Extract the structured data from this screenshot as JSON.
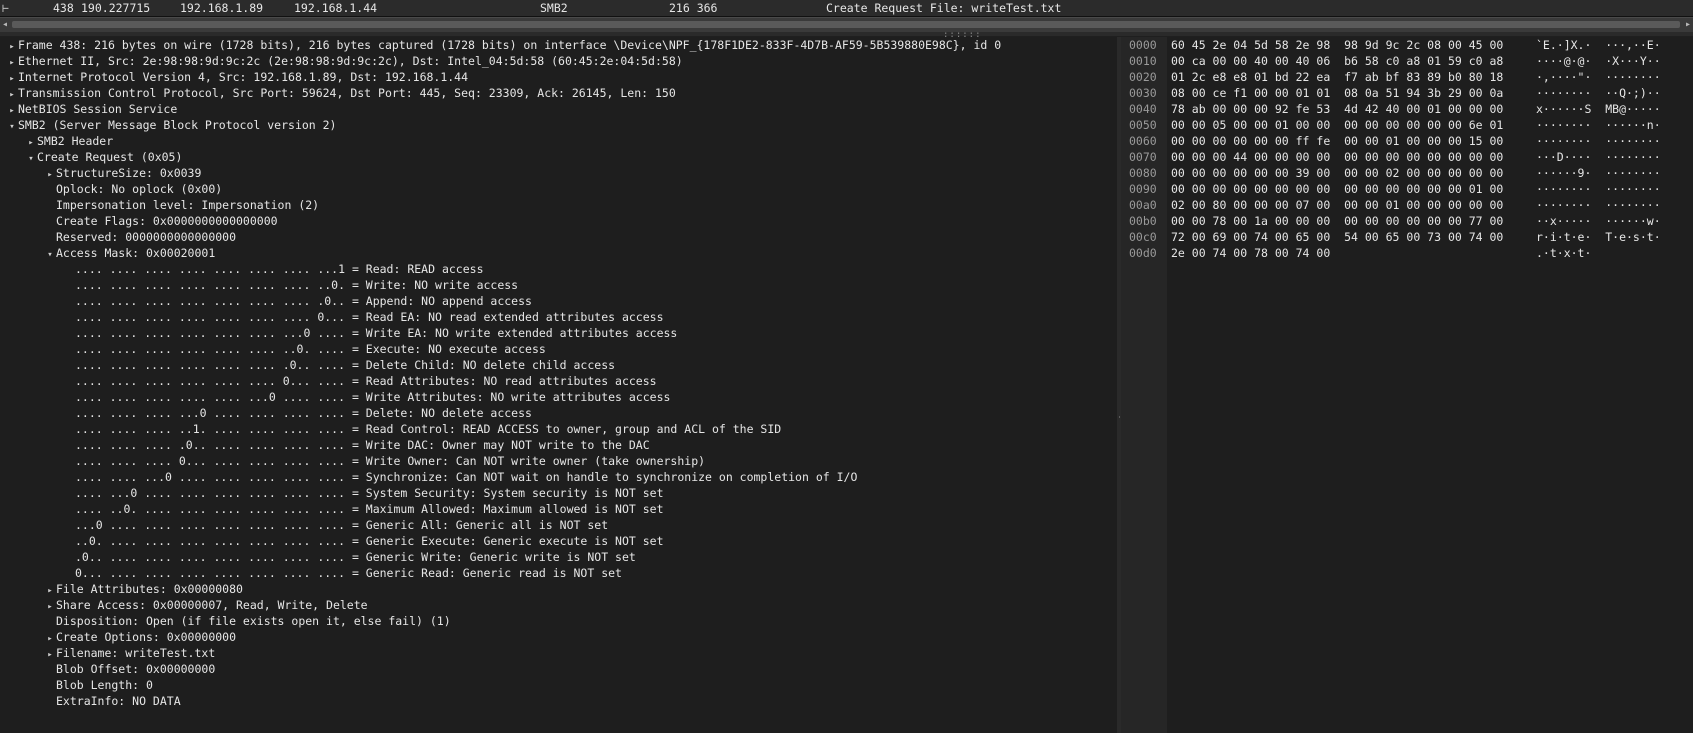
{
  "packet_list": {
    "row": {
      "marker": "⊢",
      "no": "438",
      "time": "190.227715",
      "source": "192.168.1.89",
      "destination": "192.168.1.44",
      "protocol": "SMB2",
      "length": "216 366",
      "info": "Create Request File: writeTest.txt"
    }
  },
  "detail_tree": [
    {
      "level": 0,
      "tw": "▸",
      "text": "Frame 438: 216 bytes on wire (1728 bits), 216 bytes captured (1728 bits) on interface \\Device\\NPF_{178F1DE2-833F-4D7B-AF59-5B539880E98C}, id 0"
    },
    {
      "level": 0,
      "tw": "▸",
      "text": "Ethernet II, Src: 2e:98:98:9d:9c:2c (2e:98:98:9d:9c:2c), Dst: Intel_04:5d:58 (60:45:2e:04:5d:58)"
    },
    {
      "level": 0,
      "tw": "▸",
      "text": "Internet Protocol Version 4, Src: 192.168.1.89, Dst: 192.168.1.44"
    },
    {
      "level": 0,
      "tw": "▸",
      "text": "Transmission Control Protocol, Src Port: 59624, Dst Port: 445, Seq: 23309, Ack: 26145, Len: 150"
    },
    {
      "level": 0,
      "tw": "▸",
      "text": "NetBIOS Session Service"
    },
    {
      "level": 0,
      "tw": "▾",
      "text": "SMB2 (Server Message Block Protocol version 2)"
    },
    {
      "level": 1,
      "tw": "▸",
      "text": "SMB2 Header"
    },
    {
      "level": 1,
      "tw": "▾",
      "text": "Create Request (0x05)"
    },
    {
      "level": 2,
      "tw": "▸",
      "text": "StructureSize: 0x0039"
    },
    {
      "level": 2,
      "tw": "",
      "text": "Oplock: No oplock (0x00)"
    },
    {
      "level": 2,
      "tw": "",
      "text": "Impersonation level: Impersonation (2)"
    },
    {
      "level": 2,
      "tw": "",
      "text": "Create Flags: 0x0000000000000000"
    },
    {
      "level": 2,
      "tw": "",
      "text": "Reserved: 0000000000000000"
    },
    {
      "level": 2,
      "tw": "▾",
      "text": "Access Mask: 0x00020001"
    },
    {
      "level": 3,
      "tw": "",
      "text": ".... .... .... .... .... .... .... ...1 = Read: READ access"
    },
    {
      "level": 3,
      "tw": "",
      "text": ".... .... .... .... .... .... .... ..0. = Write: NO write access"
    },
    {
      "level": 3,
      "tw": "",
      "text": ".... .... .... .... .... .... .... .0.. = Append: NO append access"
    },
    {
      "level": 3,
      "tw": "",
      "text": ".... .... .... .... .... .... .... 0... = Read EA: NO read extended attributes access"
    },
    {
      "level": 3,
      "tw": "",
      "text": ".... .... .... .... .... .... ...0 .... = Write EA: NO write extended attributes access"
    },
    {
      "level": 3,
      "tw": "",
      "text": ".... .... .... .... .... .... ..0. .... = Execute: NO execute access"
    },
    {
      "level": 3,
      "tw": "",
      "text": ".... .... .... .... .... .... .0.. .... = Delete Child: NO delete child access"
    },
    {
      "level": 3,
      "tw": "",
      "text": ".... .... .... .... .... .... 0... .... = Read Attributes: NO read attributes access"
    },
    {
      "level": 3,
      "tw": "",
      "text": ".... .... .... .... .... ...0 .... .... = Write Attributes: NO write attributes access"
    },
    {
      "level": 3,
      "tw": "",
      "text": ".... .... .... ...0 .... .... .... .... = Delete: NO delete access"
    },
    {
      "level": 3,
      "tw": "",
      "text": ".... .... .... ..1. .... .... .... .... = Read Control: READ ACCESS to owner, group and ACL of the SID"
    },
    {
      "level": 3,
      "tw": "",
      "text": ".... .... .... .0.. .... .... .... .... = Write DAC: Owner may NOT write to the DAC"
    },
    {
      "level": 3,
      "tw": "",
      "text": ".... .... .... 0... .... .... .... .... = Write Owner: Can NOT write owner (take ownership)"
    },
    {
      "level": 3,
      "tw": "",
      "text": ".... .... ...0 .... .... .... .... .... = Synchronize: Can NOT wait on handle to synchronize on completion of I/O"
    },
    {
      "level": 3,
      "tw": "",
      "text": ".... ...0 .... .... .... .... .... .... = System Security: System security is NOT set"
    },
    {
      "level": 3,
      "tw": "",
      "text": ".... ..0. .... .... .... .... .... .... = Maximum Allowed: Maximum allowed is NOT set"
    },
    {
      "level": 3,
      "tw": "",
      "text": "...0 .... .... .... .... .... .... .... = Generic All: Generic all is NOT set"
    },
    {
      "level": 3,
      "tw": "",
      "text": "..0. .... .... .... .... .... .... .... = Generic Execute: Generic execute is NOT set"
    },
    {
      "level": 3,
      "tw": "",
      "text": ".0.. .... .... .... .... .... .... .... = Generic Write: Generic write is NOT set"
    },
    {
      "level": 3,
      "tw": "",
      "text": "0... .... .... .... .... .... .... .... = Generic Read: Generic read is NOT set"
    },
    {
      "level": 2,
      "tw": "▸",
      "text": "File Attributes: 0x00000080"
    },
    {
      "level": 2,
      "tw": "▸",
      "text": "Share Access: 0x00000007, Read, Write, Delete"
    },
    {
      "level": 2,
      "tw": "",
      "text": "Disposition: Open (if file exists open it, else fail) (1)"
    },
    {
      "level": 2,
      "tw": "▸",
      "text": "Create Options: 0x00000000"
    },
    {
      "level": 2,
      "tw": "▸",
      "text": "Filename: writeTest.txt"
    },
    {
      "level": 2,
      "tw": "",
      "text": "Blob Offset: 0x00000000"
    },
    {
      "level": 2,
      "tw": "",
      "text": "Blob Length: 0"
    },
    {
      "level": 2,
      "tw": "",
      "text": "ExtraInfo: NO DATA"
    }
  ],
  "hex_dump": [
    {
      "offset": "0000",
      "bytes": "60 45 2e 04 5d 58 2e 98  98 9d 9c 2c 08 00 45 00",
      "ascii": "`E.·]X.·  ···,··E·"
    },
    {
      "offset": "0010",
      "bytes": "00 ca 00 00 40 00 40 06  b6 58 c0 a8 01 59 c0 a8",
      "ascii": "····@·@·  ·X···Y··"
    },
    {
      "offset": "0020",
      "bytes": "01 2c e8 e8 01 bd 22 ea  f7 ab bf 83 89 b0 80 18",
      "ascii": "·,····\"·  ········"
    },
    {
      "offset": "0030",
      "bytes": "08 00 ce f1 00 00 01 01  08 0a 51 94 3b 29 00 0a",
      "ascii": "········  ··Q·;)··"
    },
    {
      "offset": "0040",
      "bytes": "78 ab 00 00 00 92 fe 53  4d 42 40 00 01 00 00 00",
      "ascii": "x······S  MB@·····"
    },
    {
      "offset": "0050",
      "bytes": "00 00 05 00 00 01 00 00  00 00 00 00 00 00 6e 01",
      "ascii": "········  ······n·"
    },
    {
      "offset": "0060",
      "bytes": "00 00 00 00 00 00 ff fe  00 00 01 00 00 00 15 00",
      "ascii": "········  ········"
    },
    {
      "offset": "0070",
      "bytes": "00 00 00 44 00 00 00 00  00 00 00 00 00 00 00 00",
      "ascii": "···D····  ········"
    },
    {
      "offset": "0080",
      "bytes": "00 00 00 00 00 00 39 00  00 00 02 00 00 00 00 00",
      "ascii": "······9·  ········"
    },
    {
      "offset": "0090",
      "bytes": "00 00 00 00 00 00 00 00  00 00 00 00 00 00 01 00",
      "ascii": "········  ········"
    },
    {
      "offset": "00a0",
      "bytes": "02 00 80 00 00 00 07 00  00 00 01 00 00 00 00 00",
      "ascii": "········  ········"
    },
    {
      "offset": "00b0",
      "bytes": "00 00 78 00 1a 00 00 00  00 00 00 00 00 00 77 00",
      "ascii": "··x·····  ······w·"
    },
    {
      "offset": "00c0",
      "bytes": "72 00 69 00 74 00 65 00  54 00 65 00 73 00 74 00",
      "ascii": "r·i·t·e·  T·e·s·t·"
    },
    {
      "offset": "00d0",
      "bytes": "2e 00 74 00 78 00 74 00",
      "ascii": ".·t·x·t·"
    }
  ]
}
